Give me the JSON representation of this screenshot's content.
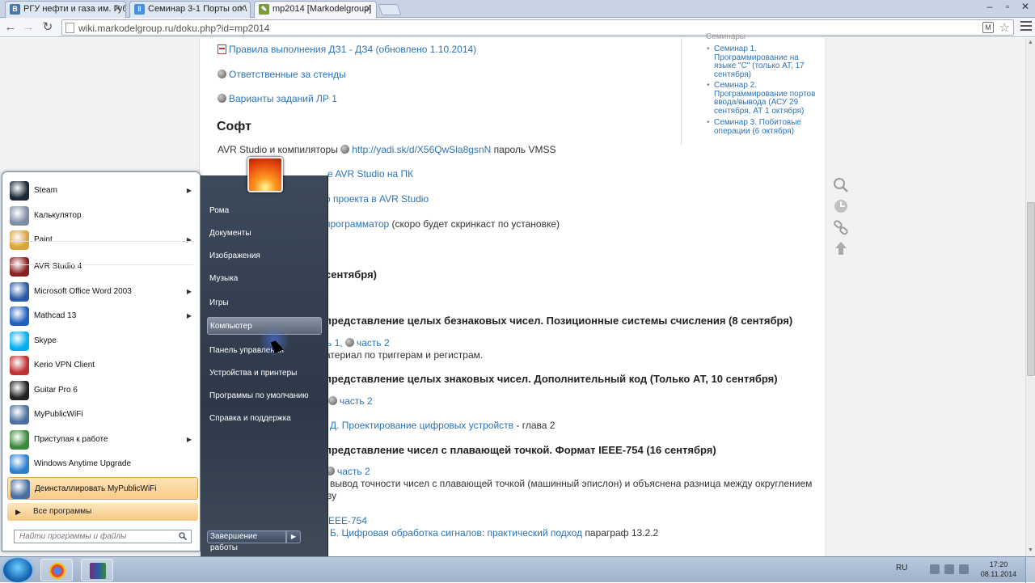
{
  "browser": {
    "tabs": [
      {
        "label": "РГУ нефти и газа им. Губ",
        "icon": "vk-icon",
        "color": "#4a76a8"
      },
      {
        "label": "Семинар 3-1 Порты on \\",
        "icon": "video-icon",
        "color": "#4a90d9"
      },
      {
        "label": "mp2014 [Markodelgroup]",
        "icon": "dokuwiki-icon",
        "color": "#7a9a40"
      }
    ],
    "url": "wiki.markodelgroup.ru/doku.php?id=mp2014",
    "ext_label": "M"
  },
  "page": {
    "links_top": [
      {
        "text": "Правила выполнения ДЗ1 - ДЗ4 (обновлено 1.10.2014)",
        "icon": "pdf-icon"
      },
      {
        "text": "Ответственные за стенды",
        "icon": "globe-icon"
      },
      {
        "text": "Варианты заданий ЛР 1",
        "icon": "globe-icon"
      }
    ],
    "soft_heading": "Софт",
    "soft_line": {
      "prefix": "AVR Studio и компиляторы",
      "link": "http://yadi.sk/d/X56QwSla8gsnN",
      "suffix": "пароль VMSS"
    },
    "partial": {
      "l1": "e AVR Studio на ПК",
      "l2": "о проекта в AVR Studio",
      "l3_link": "программатор",
      "l3_rest": "(скоро будет скринкаст по установке)",
      "l4": "сентября)",
      "h_a": "представление целых безнаковых чисел. Позиционные системы счисления (8 сентября)",
      "a1_link1": "ь 1,",
      "a1_link2": "часть 2",
      "a2": "атериал по триггерам и регистрам.",
      "h_b": "представление целых знаковых чисел. Дополнительный код (Только АТ, 10 сентября)",
      "b1_link": "часть 2",
      "b2_link": "Д. Проектирование цифровых устройств",
      "b2_rest": "- глава 2",
      "h_c": "представление чисел с плавающей точкой. Формат IEEE-754 (16 сентября)",
      "c1_link": "часть 2",
      "c2": "вывод точности чисел с плавающей точкой (машинный эпислон) и объяснена разница между округлением",
      "c3": "ву",
      "c4_link": "EEE-754",
      "c5_link": "Б. Цифровая обработка сигналов: практический подход",
      "c5_rest": "параграф 13.2.2"
    },
    "toc": {
      "cut": "Семинары",
      "items": [
        "Семинар 1. Программирование на языке \"С\" (только АТ, 17 сентября)",
        "Семинар 2. Программирование портов ввода/вывода (АСУ 29 сентября, АТ 1 октября)",
        "Семинар 3. Побитовые операции (6 октября)"
      ]
    }
  },
  "startmenu": {
    "programs": [
      {
        "label": "Steam",
        "icon": "steam-icon",
        "color": "#1b2838",
        "submenu": true
      },
      {
        "label": "Калькулятор",
        "icon": "calculator-icon",
        "color": "#7d8da5",
        "submenu": false
      },
      {
        "label": "Paint",
        "icon": "paint-icon",
        "color": "#d9a23c",
        "submenu": true
      },
      {
        "label": "AVR Studio 4",
        "icon": "avr-studio-icon",
        "color": "#8a2020",
        "submenu": false
      },
      {
        "label": "Microsoft Office Word 2003",
        "icon": "word-icon",
        "color": "#2a5aa8",
        "submenu": true
      },
      {
        "label": "Mathcad 13",
        "icon": "mathcad-icon",
        "color": "#2060c0",
        "submenu": true
      },
      {
        "label": "Skype",
        "icon": "skype-icon",
        "color": "#00aff0",
        "submenu": false
      },
      {
        "label": "Kerio VPN Client",
        "icon": "kerio-icon",
        "color": "#c03030",
        "submenu": false
      },
      {
        "label": "Guitar Pro 6",
        "icon": "guitar-pro-icon",
        "color": "#222222",
        "submenu": false
      },
      {
        "label": "MyPublicWiFi",
        "icon": "wifi-icon",
        "color": "#4a6fa0",
        "submenu": false
      },
      {
        "label": "Приступая к работе",
        "icon": "getting-started-icon",
        "color": "#3a8a3a",
        "submenu": true
      },
      {
        "label": "Windows Anytime Upgrade",
        "icon": "windows-icon",
        "color": "#2d7fd0",
        "submenu": false
      },
      {
        "label": "Деинсталлировать MyPublicWiFi",
        "icon": "uninstall-icon",
        "color": "#4a6fa0",
        "submenu": false
      }
    ],
    "all_programs": "Все программы",
    "search_placeholder": "Найти программы и файлы",
    "right": [
      "Рома",
      "Документы",
      "Изображения",
      "Музыка",
      "Игры",
      "Компьютер",
      "Панель управления",
      "Устройства и принтеры",
      "Программы по умолчанию",
      "Справка и поддержка"
    ],
    "shutdown": "Завершение работы"
  },
  "taskbar": {
    "apps": [
      {
        "name": "chrome-taskbar-icon",
        "color": "#e24b3b"
      },
      {
        "name": "winrar-taskbar-icon",
        "color": "#7a2a7a"
      }
    ],
    "lang": "RU",
    "time": "17:20",
    "date": "08.11.2014"
  }
}
